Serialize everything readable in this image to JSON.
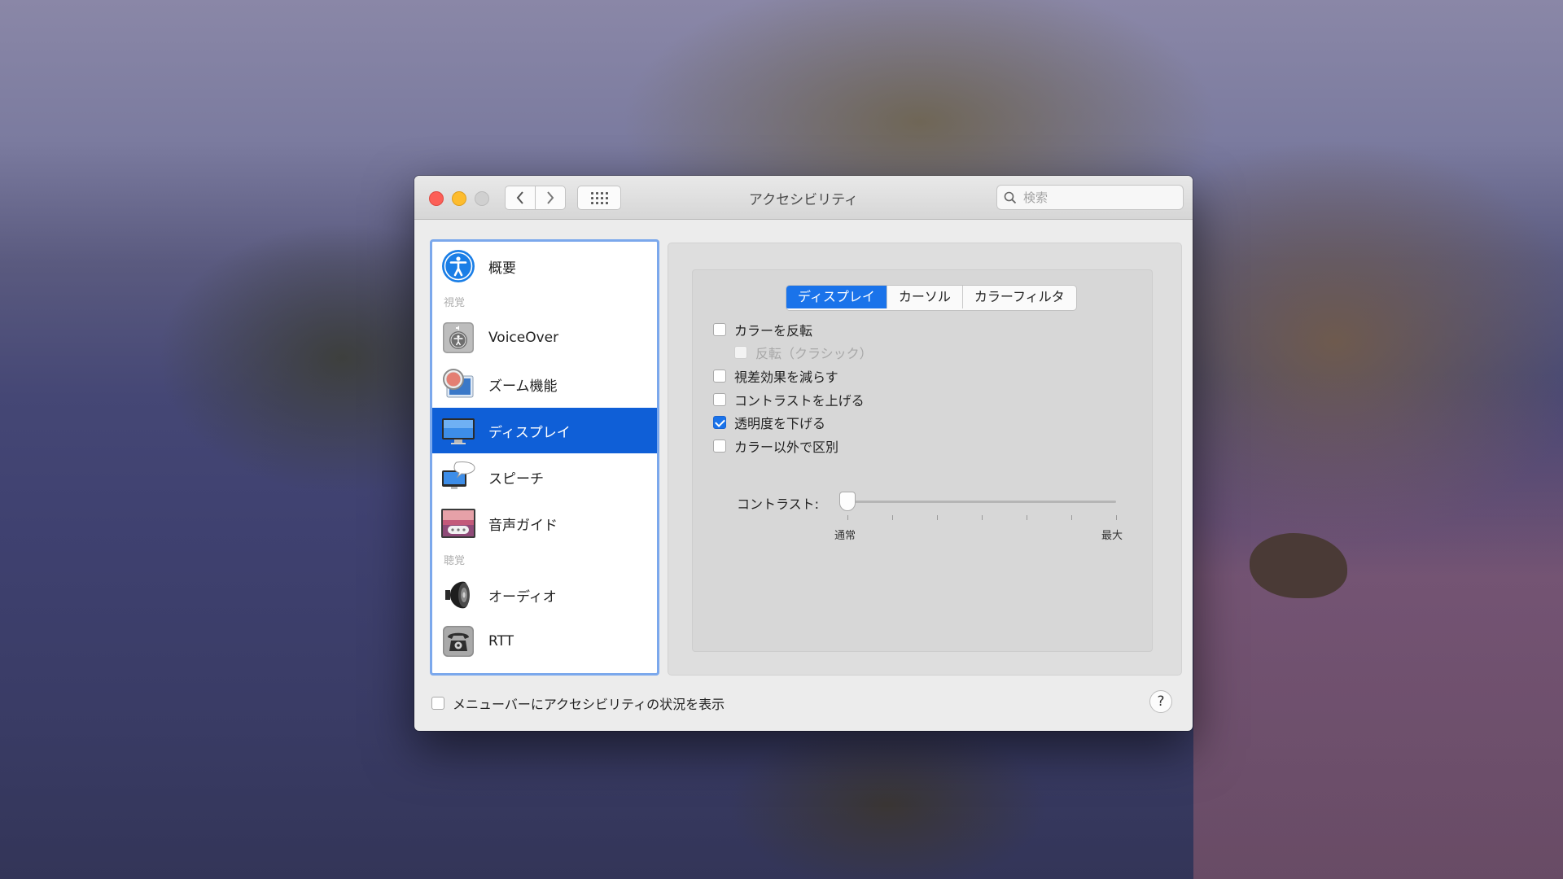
{
  "window": {
    "title": "アクセシビリティ",
    "search_placeholder": "検索",
    "back_glyph": "‹",
    "forward_glyph": "›"
  },
  "sidebar": {
    "items": [
      {
        "label": "概要",
        "icon": "accessibility-icon"
      },
      {
        "section": "視覚"
      },
      {
        "label": "VoiceOver",
        "icon": "voiceover-icon"
      },
      {
        "label": "ズーム機能",
        "icon": "zoom-icon"
      },
      {
        "label": "ディスプレイ",
        "icon": "display-icon",
        "selected": true
      },
      {
        "label": "スピーチ",
        "icon": "speech-icon"
      },
      {
        "label": "音声ガイド",
        "icon": "descriptions-icon"
      },
      {
        "section": "聴覚"
      },
      {
        "label": "オーディオ",
        "icon": "speaker-icon"
      },
      {
        "label": "RTT",
        "icon": "telephone-icon"
      }
    ]
  },
  "tabs": [
    {
      "label": "ディスプレイ",
      "active": true
    },
    {
      "label": "カーソル"
    },
    {
      "label": "カラーフィルタ"
    }
  ],
  "options": [
    {
      "label": "カラーを反転",
      "checked": false
    },
    {
      "label": "反転（クラシック）",
      "checked": false,
      "disabled": true
    },
    {
      "label": "視差効果を減らす",
      "checked": false
    },
    {
      "label": "コントラストを上げる",
      "checked": false
    },
    {
      "label": "透明度を下げる",
      "checked": true
    },
    {
      "label": "カラー以外で区別",
      "checked": false
    }
  ],
  "contrast": {
    "label": "コントラスト:",
    "min_label": "通常",
    "max_label": "最大",
    "value": 0
  },
  "footer": {
    "menubar_option": "メニューバーにアクセシビリティの状況を表示",
    "menubar_checked": false,
    "help": "?"
  },
  "colors": {
    "accent": "#1a73ea",
    "selection": "#0f5fd7",
    "close": "#fc5f57",
    "minimize": "#fdbc2e"
  }
}
